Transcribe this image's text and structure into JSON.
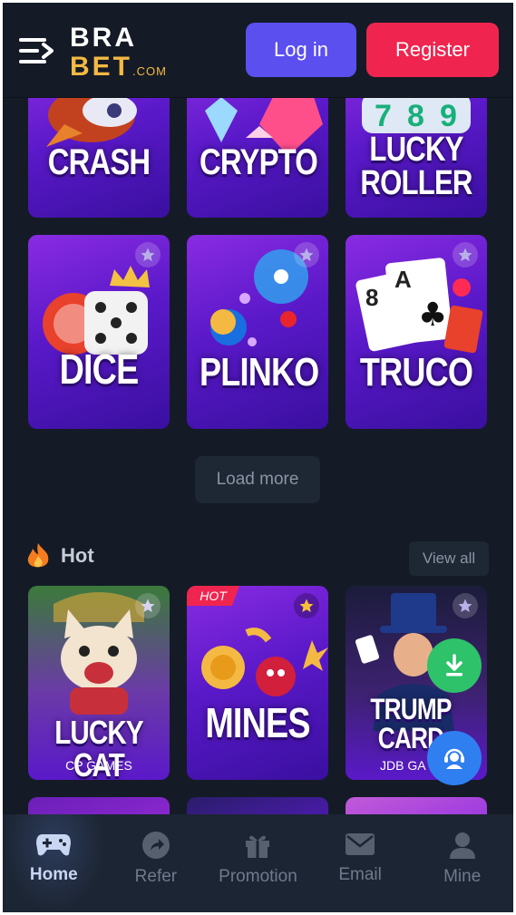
{
  "header": {
    "logo_top": "BRA",
    "logo_bottom": "BET",
    "logo_suffix": ".COM",
    "login_label": "Log in",
    "register_label": "Register"
  },
  "games_top": [
    {
      "title": "CRASH"
    },
    {
      "title": "CRYPTO"
    },
    {
      "title": "LUCKY ROLLER"
    }
  ],
  "games_row2": [
    {
      "title": "DICE"
    },
    {
      "title": "PLINKO"
    },
    {
      "title": "TRUCO"
    }
  ],
  "load_more_label": "Load more",
  "hot_section": {
    "title": "Hot",
    "view_all_label": "View all",
    "badge": "HOT",
    "games": [
      {
        "title": "LUCKY CAT",
        "provider": "CP GAMES"
      },
      {
        "title": "MINES",
        "provider": ""
      },
      {
        "title": "TRUMP CARD",
        "provider": "JDB GA"
      }
    ]
  },
  "nav": {
    "items": [
      {
        "label": "Home",
        "icon": "gamepad-icon"
      },
      {
        "label": "Refer",
        "icon": "share-icon"
      },
      {
        "label": "Promotion",
        "icon": "gift-icon"
      },
      {
        "label": "Email",
        "icon": "mail-icon"
      },
      {
        "label": "Mine",
        "icon": "user-icon"
      }
    ]
  },
  "colors": {
    "background": "#141b26",
    "login": "#5b4ff0",
    "register": "#f0254f",
    "brand_gold": "#f4b942",
    "download_fab": "#2ec26a",
    "support_fab": "#2f7ff0"
  }
}
